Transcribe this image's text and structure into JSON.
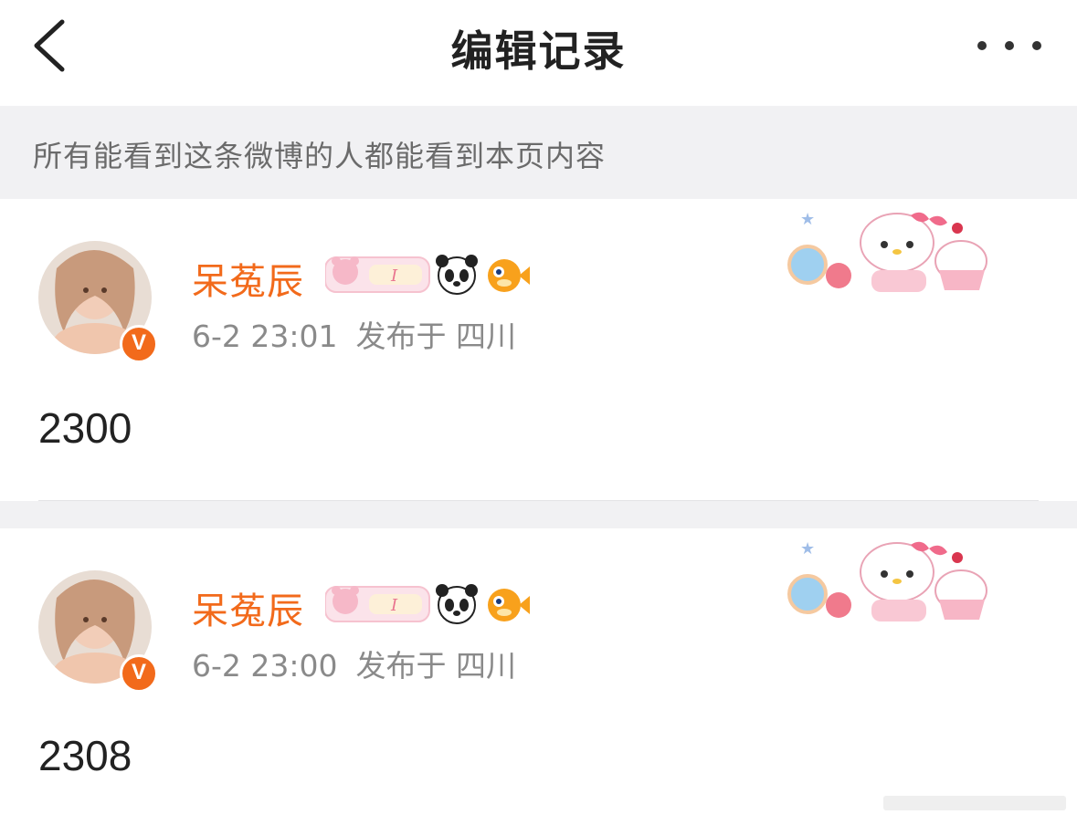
{
  "nav": {
    "title": "编辑记录"
  },
  "notice": {
    "text": "所有能看到这条微博的人都能看到本页内容"
  },
  "records": [
    {
      "username": "呆菟辰",
      "time": "6-2 23:01",
      "location": "发布于 四川",
      "content": "2300",
      "verified_badge": "V"
    },
    {
      "username": "呆菟辰",
      "time": "6-2 23:00",
      "location": "发布于 四川",
      "content": "2308",
      "verified_badge": "V"
    }
  ],
  "icons": {
    "back": "chevron-left-icon",
    "more": "more-dots-icon",
    "verified": "verified-v-icon",
    "badges": [
      "bear-fan-badge",
      "panda-emoji",
      "pufferfish-emoji"
    ],
    "sticker": "hello-kitty-sticker"
  },
  "colors": {
    "accent": "#f26a1b",
    "notice_bg": "#f1f1f3",
    "meta_text": "#8a8a8a"
  }
}
